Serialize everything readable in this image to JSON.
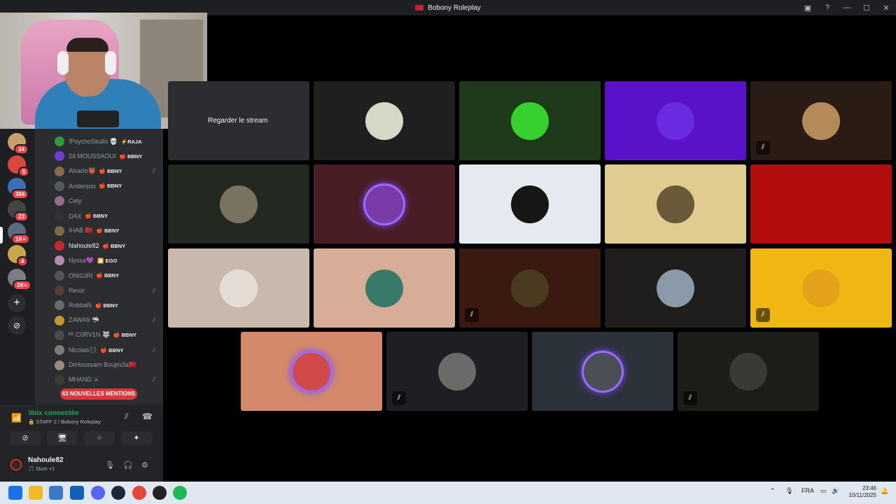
{
  "window": {
    "title": "Bobony Roleplay"
  },
  "servers": [
    {
      "badge": "34",
      "color": "#c8a06a"
    },
    {
      "badge": "5",
      "color": "#d9463b"
    },
    {
      "badge": "384",
      "color": "#3b6fb6"
    },
    {
      "badge": "23",
      "color": "#444444"
    },
    {
      "badge": "1K+",
      "color": "#5b6b7b"
    },
    {
      "badge": "4",
      "color": "#c9a64a"
    },
    {
      "badge": "2K+",
      "color": "#7a7d84"
    }
  ],
  "members": [
    {
      "name": "!PsychoSkulls 💀",
      "tag": "⚡RAJA",
      "avatar": "#2a9c3a",
      "muted": false
    },
    {
      "name": "24 MOUSSAOUI",
      "tag": "🍎 BBNY",
      "avatar": "#6b3fd1",
      "muted": false
    },
    {
      "name": "Alvario👹",
      "tag": "🍎 BBNY",
      "avatar": "#8b6b4b",
      "muted": true
    },
    {
      "name": "Anderson",
      "tag": "🍎 BBNY",
      "avatar": "#555a60",
      "muted": false
    },
    {
      "name": "Cety",
      "tag": "",
      "avatar": "#9a6b8a",
      "muted": false
    },
    {
      "name": "DAX",
      "tag": "🍎 BBNY",
      "avatar": "#333333",
      "muted": false
    },
    {
      "name": "IHAB 🇲🇦",
      "tag": "🍎 BBNY",
      "avatar": "#7a6a4a",
      "muted": false
    },
    {
      "name": "Nahoule82",
      "tag": "🍎 BBNY",
      "avatar": "#c42b2b",
      "muted": false
    },
    {
      "name": "Nyssa💜",
      "tag": "🎦 EGO",
      "avatar": "#b38bb3",
      "muted": false
    },
    {
      "name": "ONIGIRI",
      "tag": "🍎 BBNY",
      "avatar": "#555555",
      "muted": false
    },
    {
      "name": "Reviz",
      "tag": "",
      "avatar": "#5a3a3a",
      "muted": true
    },
    {
      "name": "RobbaN",
      "tag": "🍎 BBNY",
      "avatar": "#6a6a6a",
      "muted": false
    },
    {
      "name": "ZAWA9 🦈",
      "tag": "",
      "avatar": "#c9952f",
      "muted": true
    },
    {
      "name": "ᴷᴷ C0RV1N 🐺",
      "tag": "🍎 BBNY",
      "avatar": "#4a4a4a",
      "muted": false
    },
    {
      "name": "Nicolas💱",
      "tag": "🍎 BBNY",
      "avatar": "#7a7a7a",
      "muted": true
    },
    {
      "name": "DrHoussam Boujm3a🇲🇦",
      "tag": "",
      "avatar": "#9a8a7a",
      "muted": false
    },
    {
      "name": "MHAND ⚔",
      "tag": "",
      "avatar": "#3a3a3a",
      "muted": true
    }
  ],
  "mentions": "63 NOUVELLES MENTIONS",
  "voice": {
    "status": "Voix connectée",
    "channel": "🔒 STAFF 2 / Bobony Roleplay"
  },
  "user": {
    "name": "Nahoule82",
    "activity": "🎵 Oum +1"
  },
  "tooltip": "Regarder le stream",
  "tiles": [
    {
      "bg": "#2b2d31",
      "avatar": "",
      "muted": false,
      "ring": false
    },
    {
      "bg": "#1f1f1f",
      "avatar": "#d7d7c8",
      "muted": false,
      "ring": false
    },
    {
      "bg": "#1e3a1a",
      "avatar": "#36d02f",
      "muted": false,
      "ring": false
    },
    {
      "bg": "#5a12c8",
      "avatar": "#6a2be0",
      "muted": false,
      "ring": false
    },
    {
      "bg": "#2a1c14",
      "avatar": "#b48a5a",
      "muted": true,
      "ring": false
    },
    {
      "bg": "#232821",
      "avatar": "#7a7260",
      "muted": false,
      "ring": false
    },
    {
      "bg": "#4a1c24",
      "avatar": "#7a3aa8",
      "muted": false,
      "ring": true
    },
    {
      "bg": "#e6eaf0",
      "avatar": "#161616",
      "muted": false,
      "ring": false
    },
    {
      "bg": "#e0cc90",
      "avatar": "#6a5a3a",
      "muted": false,
      "ring": false
    },
    {
      "bg": "#b30d0d",
      "avatar": "",
      "muted": false,
      "ring": false
    },
    {
      "bg": "#c9b9ad",
      "avatar": "#e6dcd6",
      "muted": false,
      "ring": false
    },
    {
      "bg": "#d7ad98",
      "avatar": "#3a7a6a",
      "muted": false,
      "ring": false
    },
    {
      "bg": "#3a1a10",
      "avatar": "#4a3a20",
      "muted": true,
      "ring": false
    },
    {
      "bg": "#1f1e1c",
      "avatar": "#8a9aa8",
      "muted": false,
      "ring": false
    },
    {
      "bg": "#f0b712",
      "avatar": "#e3a21a",
      "muted": true,
      "ring": false
    },
    {
      "bg": "#d3896a",
      "avatar": "#d04a4a",
      "muted": false,
      "ring": true
    },
    {
      "bg": "#1e1f22",
      "avatar": "#6a6a6a",
      "muted": true,
      "ring": false
    },
    {
      "bg": "#2b323a",
      "avatar": "#4a4f56",
      "muted": false,
      "ring": true
    },
    {
      "bg": "#1c1c19",
      "avatar": "#3a3a34",
      "muted": true,
      "ring": false
    }
  ],
  "tray": {
    "language": "FRA",
    "time": "23:46",
    "date": "10/11/2025"
  }
}
